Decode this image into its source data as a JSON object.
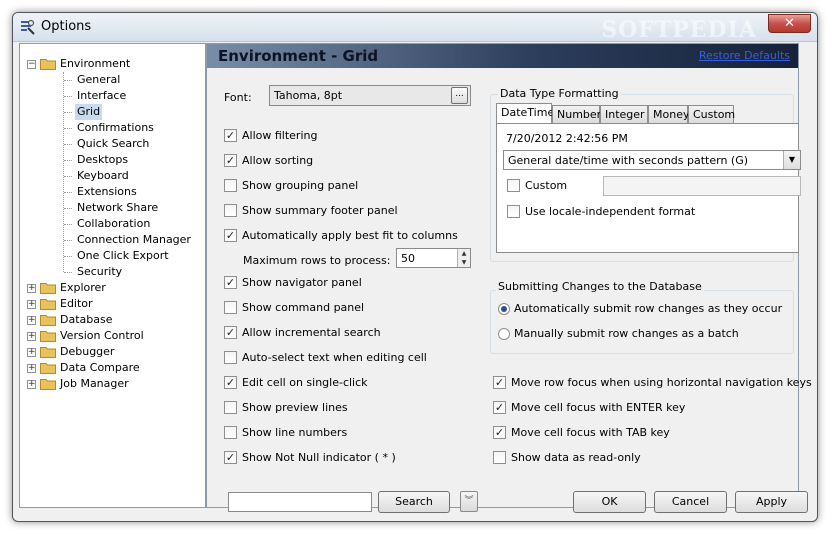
{
  "window": {
    "title": "Options",
    "close_glyph": "✕",
    "watermark": "SOFTPEDIA"
  },
  "tree": {
    "items": [
      {
        "label": "Environment",
        "level": 0,
        "expander": "−",
        "has_folder": true,
        "open": true
      },
      {
        "label": "General",
        "level": 1
      },
      {
        "label": "Interface",
        "level": 1
      },
      {
        "label": "Grid",
        "level": 1,
        "selected": true
      },
      {
        "label": "Confirmations",
        "level": 1
      },
      {
        "label": "Quick Search",
        "level": 1
      },
      {
        "label": "Desktops",
        "level": 1
      },
      {
        "label": "Keyboard",
        "level": 1
      },
      {
        "label": "Extensions",
        "level": 1
      },
      {
        "label": "Network Share",
        "level": 1
      },
      {
        "label": "Collaboration",
        "level": 1
      },
      {
        "label": "Connection Manager",
        "level": 1
      },
      {
        "label": "One Click Export",
        "level": 1
      },
      {
        "label": "Security",
        "level": 1
      },
      {
        "label": "Explorer",
        "level": 0,
        "expander": "+",
        "has_folder": true
      },
      {
        "label": "Editor",
        "level": 0,
        "expander": "+",
        "has_folder": true
      },
      {
        "label": "Database",
        "level": 0,
        "expander": "+",
        "has_folder": true
      },
      {
        "label": "Version Control",
        "level": 0,
        "expander": "+",
        "has_folder": true
      },
      {
        "label": "Debugger",
        "level": 0,
        "expander": "+",
        "has_folder": true
      },
      {
        "label": "Data Compare",
        "level": 0,
        "expander": "+",
        "has_folder": true
      },
      {
        "label": "Job Manager",
        "level": 0,
        "expander": "+",
        "has_folder": true
      }
    ]
  },
  "header": {
    "title": "Environment - Grid",
    "restore_defaults": "Restore Defaults"
  },
  "font": {
    "label": "Font:",
    "value": "Tahoma, 8pt",
    "button": "..."
  },
  "left_options": [
    {
      "label": "Allow filtering",
      "checked": true
    },
    {
      "label": "Allow sorting",
      "checked": true
    },
    {
      "label": "Show grouping panel",
      "checked": false
    },
    {
      "label": "Show summary footer panel",
      "checked": false
    },
    {
      "label": "Automatically apply best fit to columns",
      "checked": true
    },
    {
      "label": "Show navigator panel",
      "checked": true
    },
    {
      "label": "Show command panel",
      "checked": false
    },
    {
      "label": "Allow incremental search",
      "checked": true
    },
    {
      "label": "Auto-select text when editing cell",
      "checked": false
    },
    {
      "label": "Edit cell on single-click",
      "checked": true
    },
    {
      "label": "Show preview lines",
      "checked": false
    },
    {
      "label": "Show line numbers",
      "checked": false
    },
    {
      "label": "Show Not Null indicator ( * )",
      "checked": true
    }
  ],
  "max_rows": {
    "label": "Maximum rows to process:",
    "value": "50"
  },
  "data_type": {
    "group_title": "Data Type Formatting",
    "tabs": [
      "DateTime",
      "Number",
      "Integer",
      "Money",
      "Custom"
    ],
    "active_tab": 0,
    "sample": "7/20/2012 2:42:56 PM",
    "pattern": "General date/time with seconds pattern (G)",
    "custom_label": "Custom",
    "custom_checked": false,
    "custom_value": "",
    "locale_label": "Use locale-independent format",
    "locale_checked": false
  },
  "submit": {
    "group_title": "Submitting Changes to the Database",
    "options": [
      {
        "label": "Automatically submit row changes as they occur",
        "selected": true
      },
      {
        "label": "Manually submit row changes as a batch",
        "selected": false
      }
    ]
  },
  "right_options": [
    {
      "label": "Move row focus when using horizontal navigation keys",
      "checked": true
    },
    {
      "label": "Move cell focus with ENTER key",
      "checked": true
    },
    {
      "label": "Move cell focus with TAB key",
      "checked": true
    },
    {
      "label": "Show data as read-only",
      "checked": false
    }
  ],
  "footer": {
    "search_value": "",
    "search_button": "Search",
    "ok": "OK",
    "cancel": "Cancel",
    "apply": "Apply"
  },
  "icons": {
    "app": "options-app-icon",
    "folder_color": "#e8c25a",
    "check_glyph": "✓"
  },
  "colors": {
    "header_gradient_dark": "#16223a",
    "link": "#3b5fd6",
    "selection": "#c9d9ee"
  }
}
